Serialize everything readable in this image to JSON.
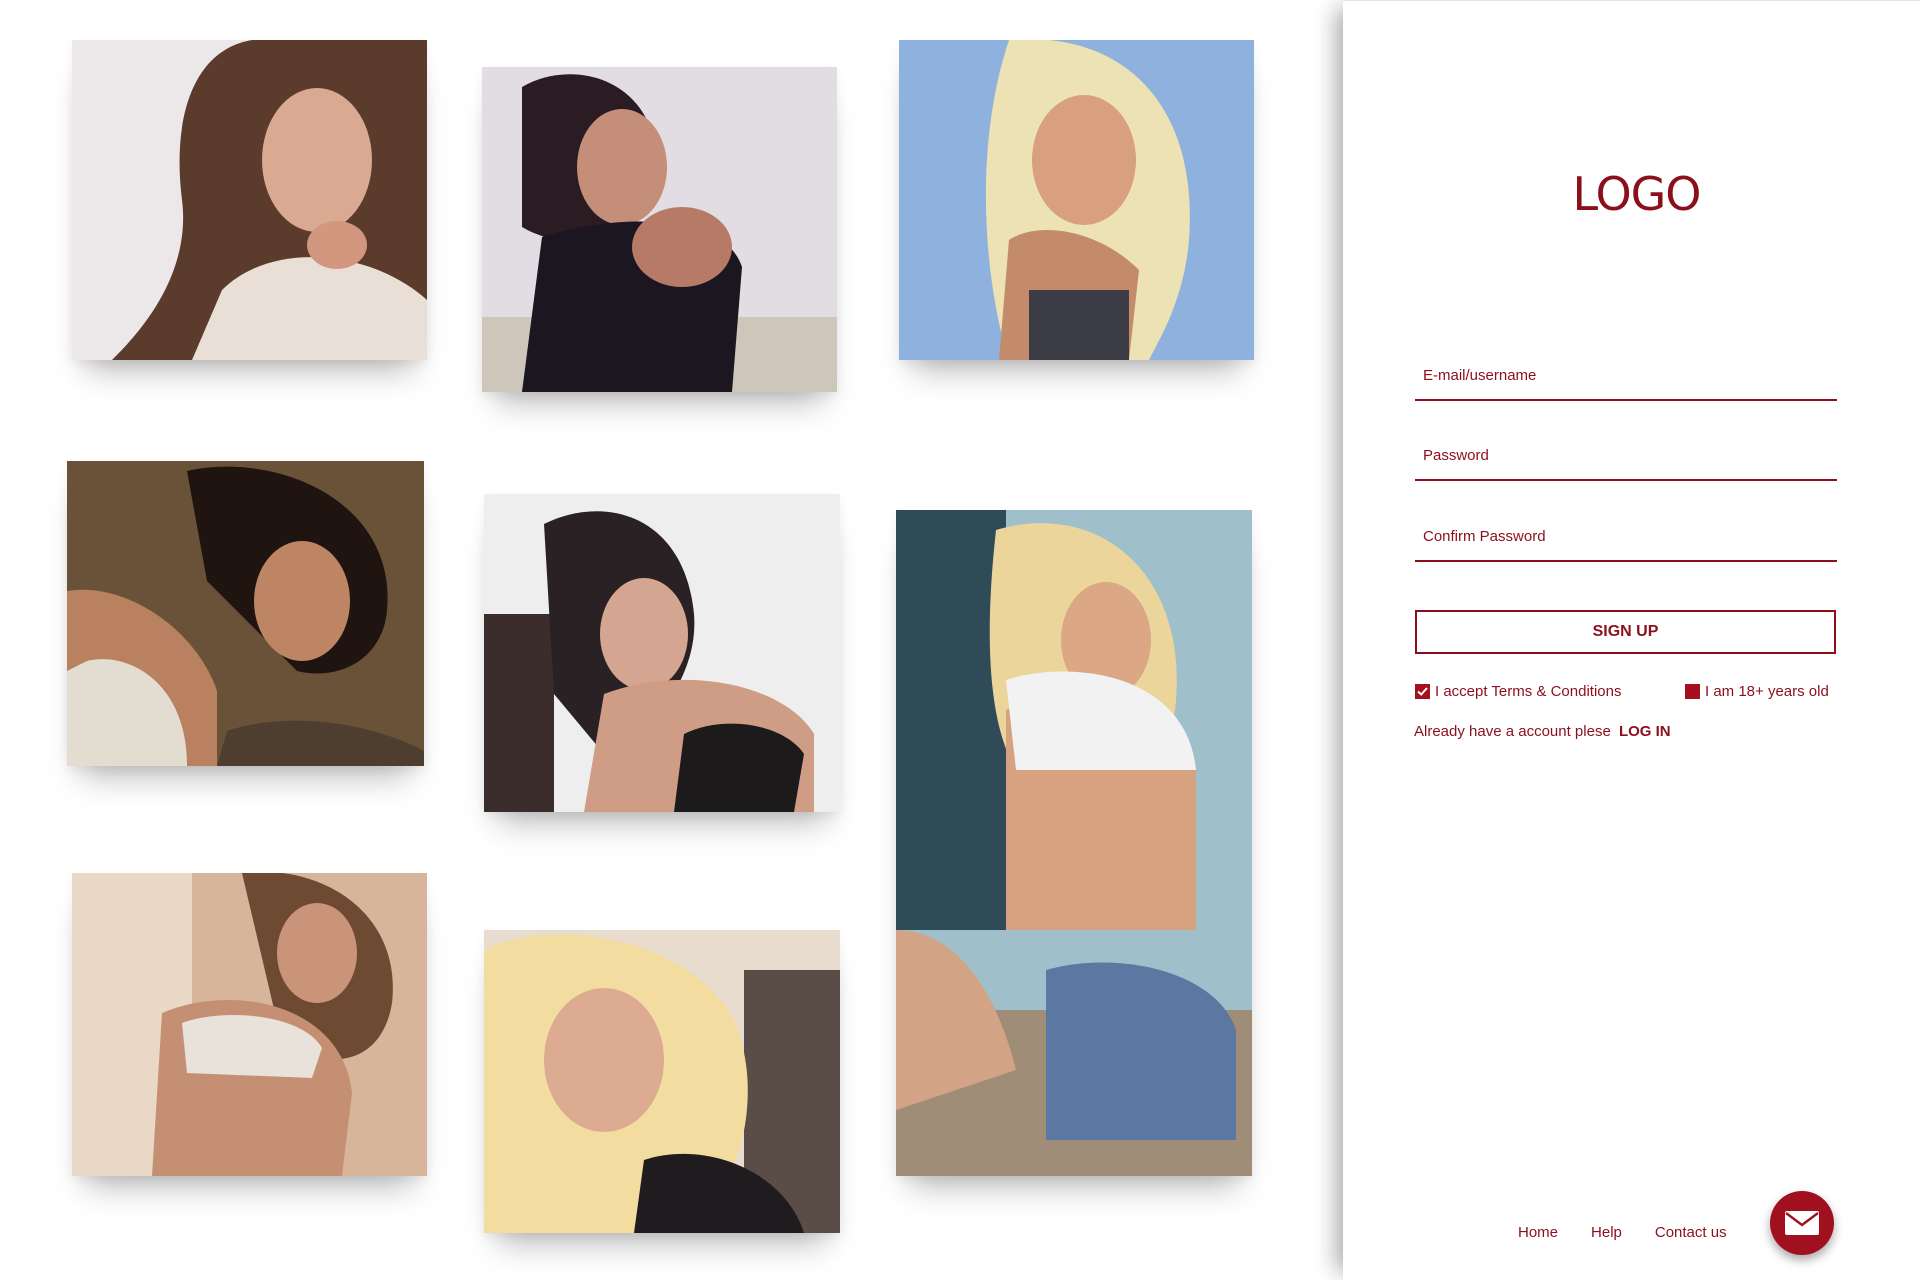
{
  "gallery": {
    "photos": [
      {
        "id": "p1",
        "palette": [
          "#ede9ea",
          "#5b3b2c",
          "#d8a88f"
        ]
      },
      {
        "id": "p2",
        "palette": [
          "#e1dde1",
          "#2b1d23",
          "#b0796b"
        ]
      },
      {
        "id": "p3",
        "palette": [
          "#8fb1de",
          "#ece2b4",
          "#c69277"
        ]
      },
      {
        "id": "p4",
        "palette": [
          "#6a5238",
          "#1f140f",
          "#b98160"
        ]
      },
      {
        "id": "p5",
        "palette": [
          "#efeeee",
          "#2a2124",
          "#d2a38f"
        ]
      },
      {
        "id": "p6",
        "palette": [
          "#9fc0cb",
          "#ecd59a",
          "#d7a280",
          "#5b78a3"
        ]
      },
      {
        "id": "p7",
        "palette": [
          "#d6b59a",
          "#6e4a33",
          "#c58f73"
        ]
      },
      {
        "id": "p8",
        "palette": [
          "#e7dccd",
          "#f2dc9f",
          "#d8a58c"
        ]
      }
    ]
  },
  "panel": {
    "logo": "LOGO",
    "fields": {
      "email": "E-mail/username",
      "password": "Password",
      "confirm": "Confirm Password"
    },
    "signup_label": "SIGN UP",
    "terms_label": "I accept Terms & Conditions",
    "age_label": "I am 18+ years old",
    "already_text": "Already have a account plese",
    "login_label": "LOG IN",
    "footer": {
      "home": "Home",
      "help": "Help",
      "contact": "Contact us"
    },
    "mail_icon": "mail-icon"
  },
  "colors": {
    "accent": "#8c0f1c",
    "accent_fill": "#a5101f"
  }
}
